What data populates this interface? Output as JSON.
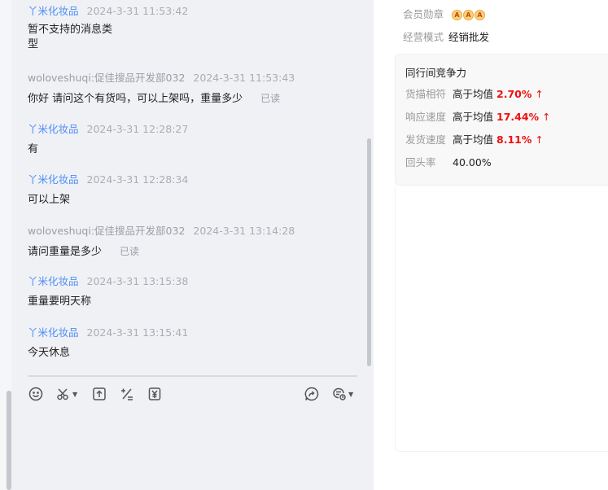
{
  "messages": [
    {
      "sender": "丫米化妆品",
      "role": "seller",
      "time": "2024-3-31 11:53:42",
      "text": "暂不支持的消息类\n型",
      "read": ""
    },
    {
      "sender": "woloveshuqi:促佳搜品开发部032",
      "role": "buyer",
      "time": "2024-3-31 11:53:43",
      "text": "你好 请问这个有货吗，可以上架吗，重量多少",
      "read": "已读"
    },
    {
      "sender": "丫米化妆品",
      "role": "seller",
      "time": "2024-3-31 12:28:27",
      "text": "有",
      "read": ""
    },
    {
      "sender": "丫米化妆品",
      "role": "seller",
      "time": "2024-3-31 12:28:34",
      "text": "可以上架",
      "read": ""
    },
    {
      "sender": "woloveshuqi:促佳搜品开发部032",
      "role": "buyer",
      "time": "2024-3-31 13:14:28",
      "text": "请问重量是多少",
      "read": "已读"
    },
    {
      "sender": "丫米化妆品",
      "role": "seller",
      "time": "2024-3-31 13:15:38",
      "text": "重量要明天称",
      "read": ""
    },
    {
      "sender": "丫米化妆品",
      "role": "seller",
      "time": "2024-3-31 13:15:41",
      "text": "今天休息",
      "read": ""
    }
  ],
  "toolbar": {
    "icons": [
      "emoji-icon",
      "scissors-icon",
      "upload-icon",
      "calculator-icon",
      "yuan-coupon-icon",
      "share-icon",
      "quick-reply-icon"
    ]
  },
  "profile": {
    "medal_label": "会员勋章",
    "medal_badges": [
      "A",
      "A",
      "A"
    ],
    "mode_label": "经营模式",
    "mode_value": "经销批发"
  },
  "competitiveness": {
    "title": "同行间竞争力",
    "rows": [
      {
        "label": "货描相符",
        "prefix": "高于均值",
        "value": "2.70%",
        "arrow": "↑"
      },
      {
        "label": "响应速度",
        "prefix": "高于均值",
        "value": "17.44%",
        "arrow": "↑"
      },
      {
        "label": "发货速度",
        "prefix": "高于均值",
        "value": "8.11%",
        "arrow": "↑"
      }
    ],
    "repeat_label": "回头率",
    "repeat_value": "40.00%"
  }
}
